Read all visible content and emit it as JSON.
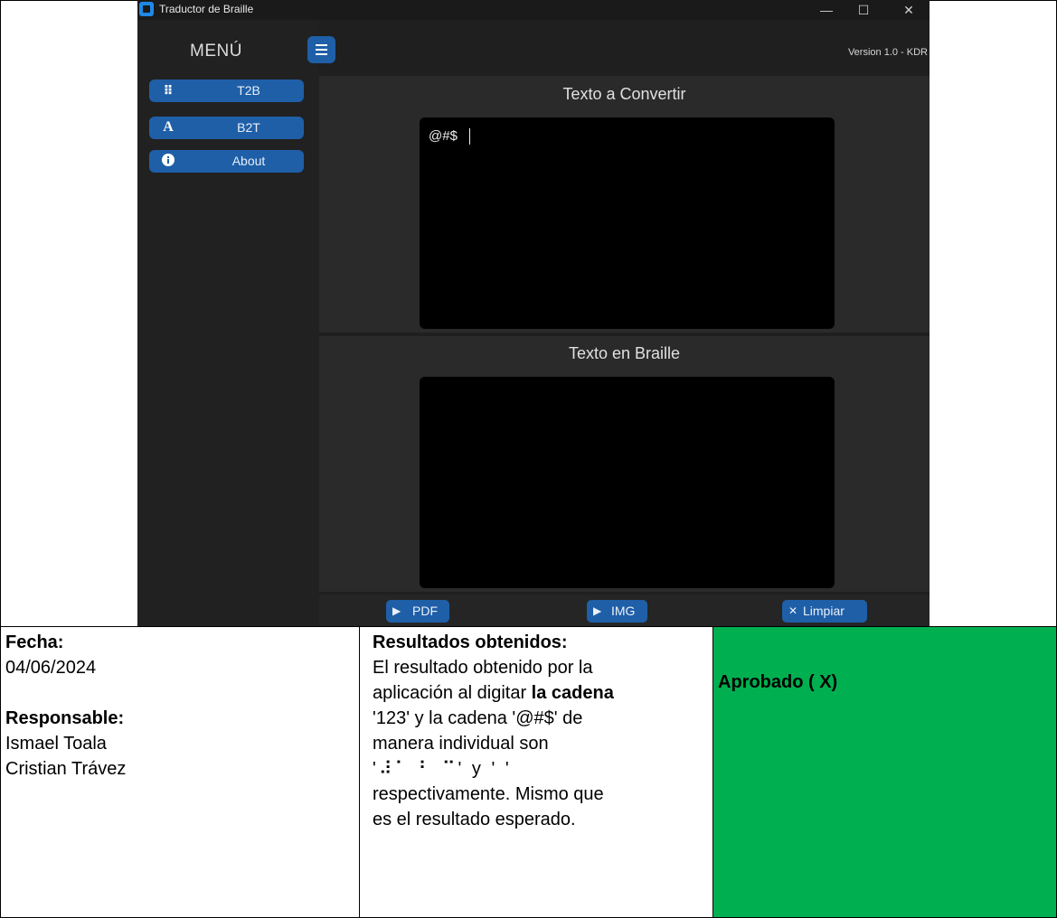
{
  "app": {
    "window_title": "Traductor de Braille",
    "window_buttons": {
      "minimize": "—",
      "maximize": "☐",
      "close": "✕"
    },
    "menu_title": "MENÚ",
    "version": "Version 1.0 - KDR",
    "nav": [
      {
        "icon": "⠿",
        "label": "T2B"
      },
      {
        "icon": "A",
        "label": "B2T"
      },
      {
        "icon": "i",
        "label": "About"
      }
    ],
    "input_panel": {
      "title": "Texto a Convertir",
      "value": "@#$"
    },
    "output_panel": {
      "title": "Texto en Braille",
      "value": ""
    },
    "actions": {
      "pdf": {
        "icon": "▶",
        "label": "PDF"
      },
      "img": {
        "icon": "▶",
        "label": "IMG"
      },
      "clear": {
        "icon": "✕",
        "label": "Limpiar"
      }
    }
  },
  "table": {
    "date_label": "Fecha:",
    "date_value": "04/06/2024",
    "responsible_label": "Responsable:",
    "responsible_names": [
      "Ismael Toala",
      "Cristian Trávez"
    ],
    "results_label": "Resultados obtenidos:",
    "results_text_1": "El resultado obtenido por la",
    "results_text_2": "aplicación al digitar",
    "results_text_bold": "la cadena",
    "results_text_3": "'123' y la cadena '@#$' de",
    "results_text_4": "manera individual son",
    "results_braille": "'⠼⠁ ⠃ ⠉' y ' '",
    "results_text_5": "respectivamente. Mismo que",
    "results_text_6": "es el resultado esperado.",
    "status": "Aprobado ( X)",
    "status_color": "#00b050"
  }
}
